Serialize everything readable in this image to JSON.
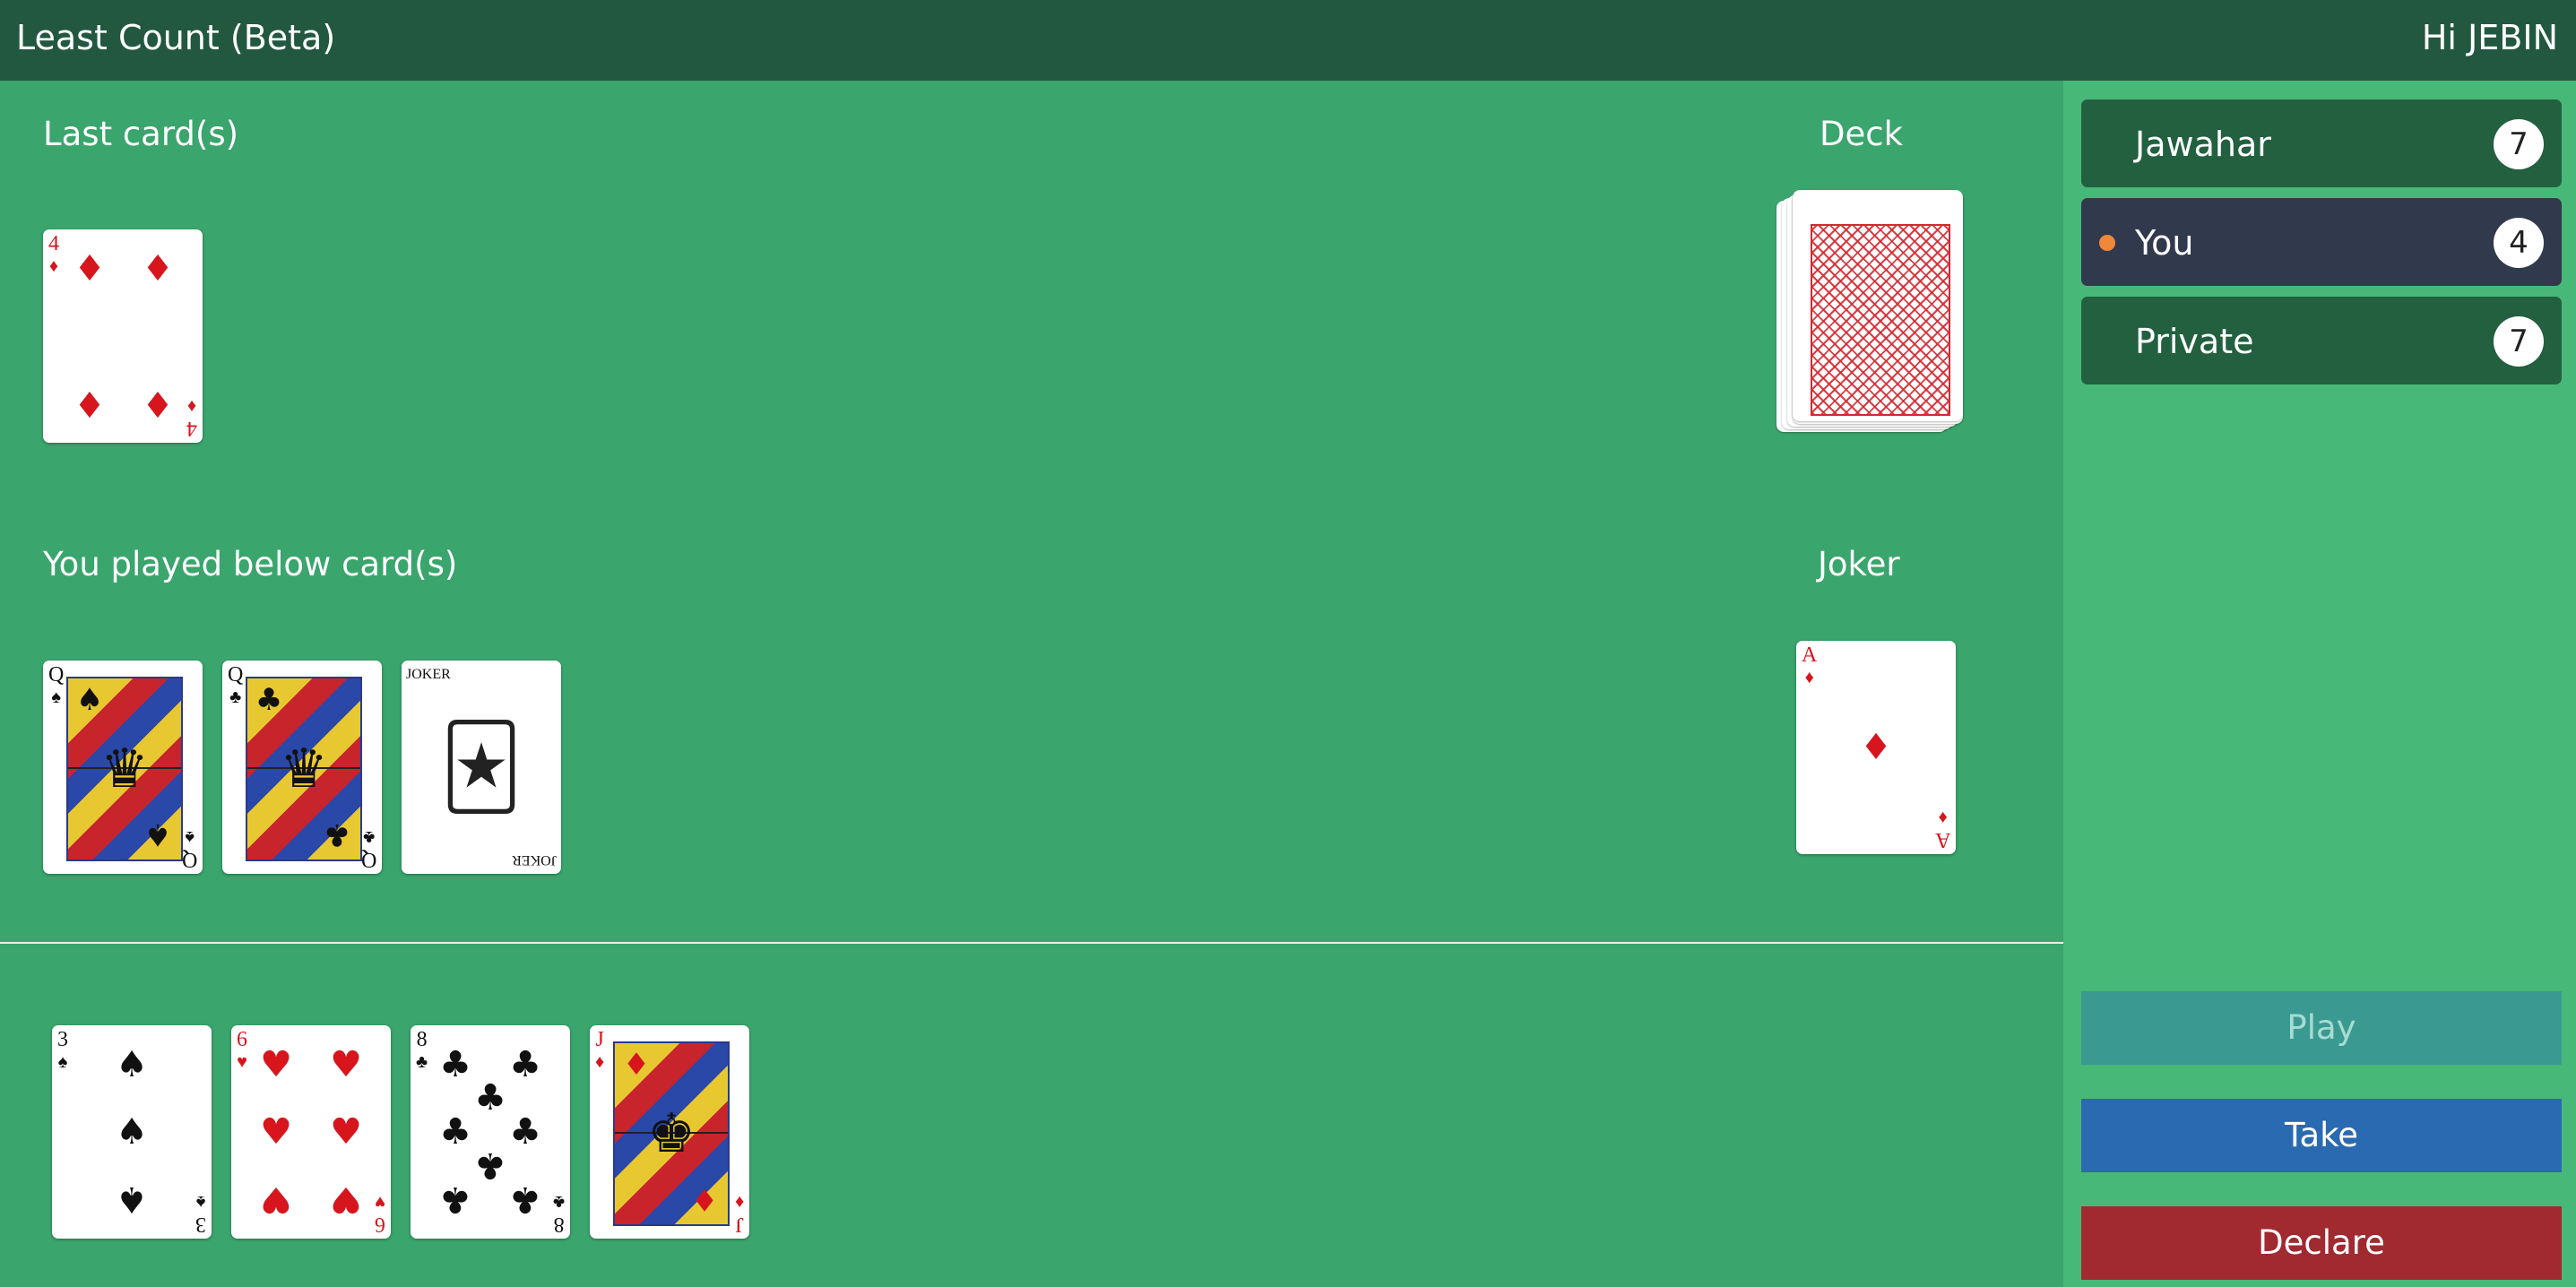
{
  "header": {
    "title": "Least Count (Beta)",
    "greeting": "Hi JEBIN"
  },
  "last_cards": {
    "label": "Last card(s)",
    "cards": [
      {
        "rank": "4",
        "suit": "♦"
      }
    ]
  },
  "deck": {
    "label": "Deck"
  },
  "played": {
    "label": "You played below card(s)",
    "cards": [
      {
        "rank": "Q",
        "suit": "♠"
      },
      {
        "rank": "Q",
        "suit": "♣"
      },
      {
        "rank": "JOKER",
        "suit": ""
      }
    ]
  },
  "joker": {
    "label": "Joker",
    "card": {
      "rank": "A",
      "suit": "♦"
    }
  },
  "hand": {
    "cards": [
      {
        "rank": "3",
        "suit": "♠"
      },
      {
        "rank": "6",
        "suit": "♥"
      },
      {
        "rank": "8",
        "suit": "♣"
      },
      {
        "rank": "J",
        "suit": "♦"
      }
    ]
  },
  "players": [
    {
      "name": "Jawahar",
      "count": "7",
      "active": false
    },
    {
      "name": "You",
      "count": "4",
      "active": true
    },
    {
      "name": "Private",
      "count": "7",
      "active": false
    }
  ],
  "actions": {
    "play": "Play",
    "take": "Take",
    "declare": "Declare"
  },
  "colors": {
    "header_bg": "#225840",
    "table_bg": "#3aa56d",
    "sidebar_bg": "#48b878",
    "player_bg": "#22603f",
    "player_active_bg": "#303a4c",
    "turn_indicator": "#f0883a",
    "play_button": "#3a9a92",
    "take_button": "#2a6ab0",
    "declare_button": "#a02a30",
    "red_suit": "#d7151d"
  }
}
